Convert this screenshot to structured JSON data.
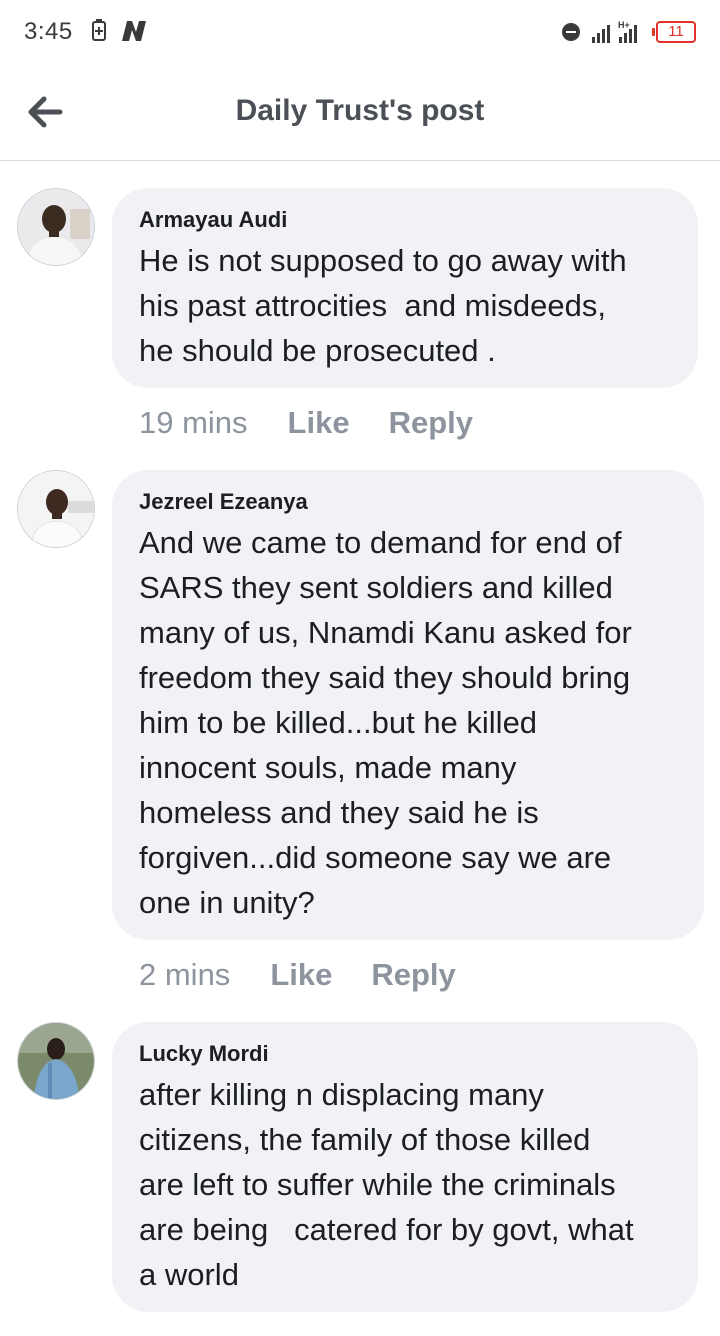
{
  "status_bar": {
    "time": "3:45",
    "battery_level": "11"
  },
  "header": {
    "title": "Daily Trust's post"
  },
  "comments": [
    {
      "author": "Armayau Audi",
      "text": "He is not supposed to go away with\nhis past attrocities  and misdeeds,\nhe should be prosecuted .",
      "time": "19 mins",
      "like_label": "Like",
      "reply_label": "Reply"
    },
    {
      "author": "Jezreel Ezeanya",
      "text": "And we came to demand for end of\nSARS they sent soldiers and killed\nmany of us, Nnamdi Kanu asked for\nfreedom they said they should bring\nhim to be killed...but he killed\ninnocent souls, made many\nhomeless and they said he is\nforgiven...did someone say we are\none in unity?",
      "time": "2 mins",
      "like_label": "Like",
      "reply_label": "Reply"
    },
    {
      "author": "Lucky Mordi",
      "text": "after killing n displacing many\ncitizens, the family of those killed\nare left to suffer while the criminals\nare being   catered for by govt, what\na world"
    }
  ],
  "icons": {
    "back": "arrow-left-icon",
    "battery_saver": "battery-saver-icon",
    "notification": "n-app-icon",
    "dnd": "do-not-disturb-icon",
    "signal": "signal-icon",
    "battery": "battery-icon"
  },
  "colors": {
    "bubble": "#f0f2f5",
    "meta_text": "#8d949e",
    "title_text": "#4b4f56",
    "battery_low": "#e0312a"
  }
}
